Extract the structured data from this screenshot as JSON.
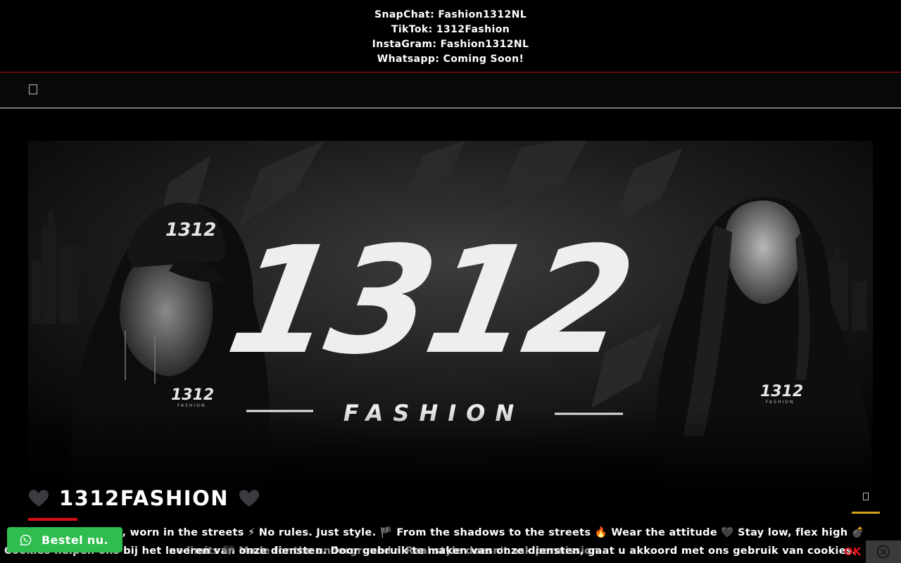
{
  "topbar": {
    "lines": [
      "SnapChat: Fashion1312NL",
      "TikTok: 1312Fashion",
      "InstaGram: Fashion1312NL",
      "Whatsapp: Coming Soon!"
    ]
  },
  "nav": {
    "toggle_icon": "menu-icon"
  },
  "hero": {
    "logo_number": "1312",
    "logo_word": "FASHION",
    "cap_text": "1312",
    "hoodie_text": "1312",
    "hoodie_sub": "FASHION"
  },
  "brand": {
    "title": "1312FASHION",
    "icon": "black-heart-icon"
  },
  "tagline": {
    "text": "ark, worn in the streets ⚡ No rules. Just style. 🏴 From the shadows to the streets 🔥 Wear the attitude 🖤 Stay low, flex high 💣"
  },
  "cookie": {
    "text": "Cookies helpen ons bij het leveren van onze diensten. Door gebruik te maken van onze diensten, gaat u akkoord met ons gebruik van cookies.",
    "ok_label": "OK",
    "overlap_text": "no limits 🖤 Made for the underground ⚡ Real style doesn't ask permission"
  },
  "whatsapp": {
    "label": "Bestel nu."
  },
  "colors": {
    "accent_red": "#d60e16",
    "cookie_ok": "#e3131b",
    "whatsapp_green": "#2ebd4e",
    "gold_bar": "#d4a017"
  }
}
